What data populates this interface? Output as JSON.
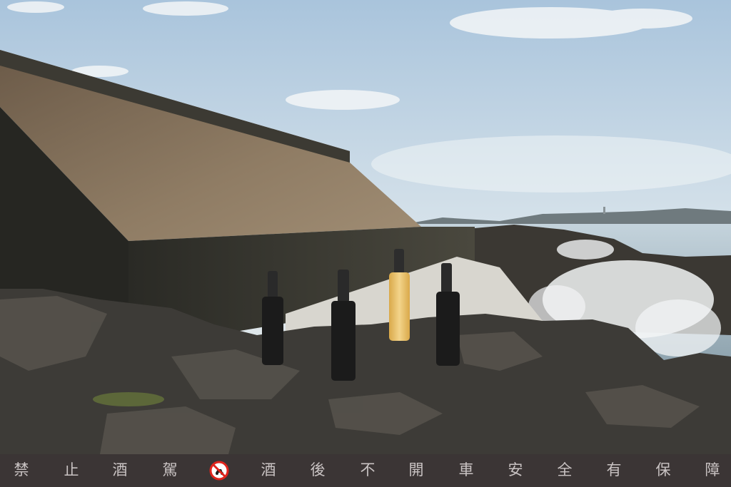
{
  "photo": {
    "description_icon": "bottles-on-rocks",
    "bottles": [
      {
        "color": "#1b1b1b"
      },
      {
        "color": "#1b1b1b"
      },
      {
        "color": "#e8c36a"
      },
      {
        "color": "#1b1b1b"
      }
    ]
  },
  "footer": {
    "chars": [
      "禁",
      "止",
      "酒",
      "駕",
      "酒",
      "後",
      "不",
      "開",
      "車",
      "安",
      "全",
      "有",
      "保",
      "障"
    ],
    "no_drink_drive_icon": "no-drink-drive-icon",
    "bg_color": "#3b3535",
    "text_color": "#c9c3c3",
    "icon_color": "#e0241c"
  }
}
